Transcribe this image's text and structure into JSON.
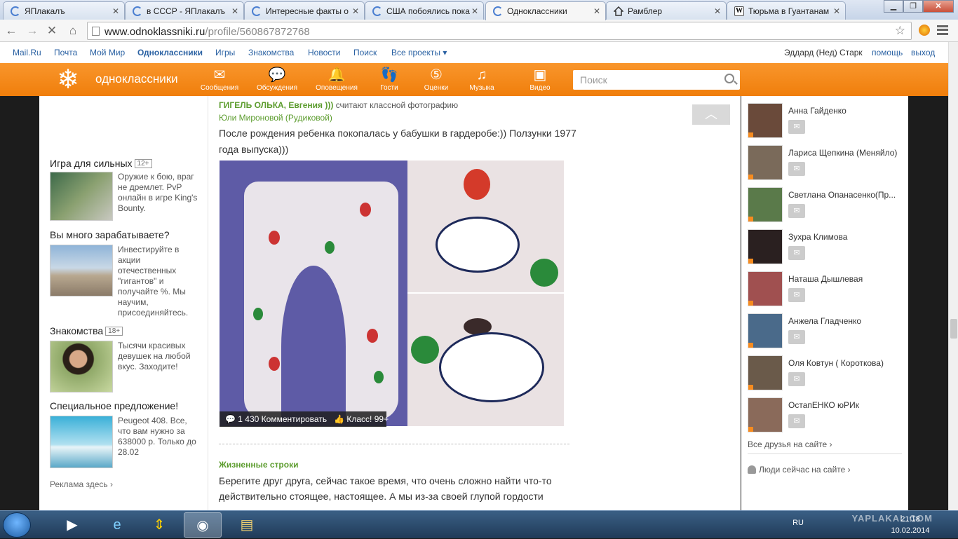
{
  "browser": {
    "tabs": [
      {
        "title": "ЯПлакалъ",
        "icon": "loading-icon"
      },
      {
        "title": "в СССР - ЯПлакалъ",
        "icon": "loading-icon"
      },
      {
        "title": "Интересные факты о",
        "icon": "loading-icon"
      },
      {
        "title": "США побоялись пока",
        "icon": "loading-icon"
      },
      {
        "title": "Одноклассники",
        "icon": "loading-icon",
        "active": true
      },
      {
        "title": "Рамблер",
        "icon": "home-icon"
      },
      {
        "title": "Тюрьма в Гуантанам",
        "icon": "wikipedia-icon"
      }
    ],
    "url_domain": "www.odnoklassniki.ru",
    "url_path": "/profile/560867872768"
  },
  "portal": {
    "links": [
      "Mail.Ru",
      "Почта",
      "Мой Мир",
      "Одноклассники",
      "Игры",
      "Знакомства",
      "Новости",
      "Поиск",
      "Все проекты ▾"
    ],
    "user": "Эддард (Нед) Старк",
    "help": "помощь",
    "logout": "выход"
  },
  "ok_header": {
    "logo": "одноклассники",
    "nav": [
      {
        "label": "Сообщения",
        "icon": "envelope-icon"
      },
      {
        "label": "Обсуждения",
        "icon": "chat-bubbles-icon"
      },
      {
        "label": "Оповещения",
        "icon": "bell-icon"
      },
      {
        "label": "Гости",
        "icon": "footprints-icon"
      },
      {
        "label": "Оценки",
        "icon": "rating-icon"
      },
      {
        "label": "Музыка",
        "icon": "music-icon"
      },
      {
        "label": "Видео",
        "icon": "video-icon"
      }
    ],
    "search_placeholder": "Поиск"
  },
  "ads": [
    {
      "title": "Игра для сильных",
      "age": "12+",
      "text": "Оружие к бою, враг не дремлет. PvP онлайн в игре King's Bounty."
    },
    {
      "title": "Вы много зарабатываете?",
      "age": "",
      "text": "Инвестируйте в акции отечественных \"гигантов\" и получайте %. Мы научим, присоединяйтесь."
    },
    {
      "title": "Знакомства",
      "age": "18+",
      "text": "Тысячи красивых девушек на любой вкус. Заходите!"
    },
    {
      "title": "Специальное предложение!",
      "age": "",
      "text": "Peugeot 408. Все, что вам нужно за 638000 р. Только до 28.02"
    }
  ],
  "ads_footer": "Реклама здесь ›",
  "feed": {
    "who": "ГИГЕЛЬ ОЛЬКА, Евгения )))",
    "who_action": " считают классной фотографию",
    "owner": "Юли Мироновой (Рудиковой)",
    "text": "После рождения ребенка покопалась у бабушки в гардеробе:)) Ползунки 1977 года выпуска)))",
    "comments": "1 430 Комментировать",
    "likes": "Класс! 99+",
    "section2_title": "Жизненные строки",
    "section2_text": "Берегите друг друга, сейчас такое время, что очень сложно найти что-то действительно стоящее, настоящее. А мы из-за своей глупой гордости"
  },
  "friends": [
    {
      "name": "Анна Гайденко",
      "avatar_color": "#6a4a3a"
    },
    {
      "name": "Лариса Щепкина (Меняйло)",
      "avatar_color": "#7a6a5a"
    },
    {
      "name": "Светлана Опанасенко(Пр...",
      "avatar_color": "#5a7a4a"
    },
    {
      "name": "Зухра Климова",
      "avatar_color": "#2a2020"
    },
    {
      "name": "Наташа Дышлевая",
      "avatar_color": "#a05050"
    },
    {
      "name": "Анжела Гладченко",
      "avatar_color": "#4a6a8a"
    },
    {
      "name": "Оля Ковтун ( Короткова)",
      "avatar_color": "#6a5a4a"
    },
    {
      "name": "ОстапЕНКО юРИк",
      "avatar_color": "#8a6a5a"
    }
  ],
  "friends_all": "Все друзья на сайте ›",
  "people_online": "Люди сейчас на сайте ›",
  "taskbar": {
    "lang": "RU",
    "time": "21:18",
    "date": "10.02.2014",
    "watermark": "YAPLAKAL.COM"
  }
}
